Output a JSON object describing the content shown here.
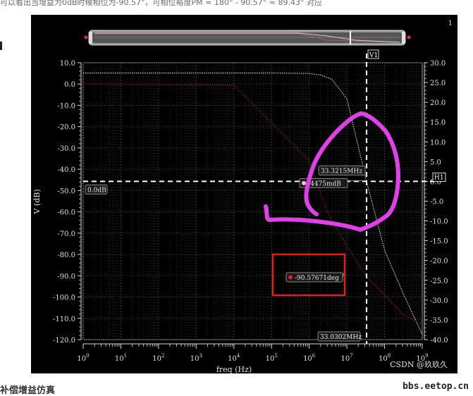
{
  "page": {
    "caption": "可以看出当增益为0dB时候相位为-90.57°，可相位裕度PM = 180° - 90.57° ≈ 89.43° 对应",
    "footer_text": "补偿增益仿真",
    "site_watermark": "bbs.eetop.cn",
    "csdn_watermark": "CSDN @玖玖久",
    "page_number": "1"
  },
  "chart_data": {
    "type": "line",
    "xlabel": "freq (Hz)",
    "ylabel_left": "V (dB)",
    "ylabel_right": "V (deg)",
    "x_scale": "log",
    "xlim": [
      1,
      1000000000
    ],
    "x_ticks": [
      {
        "value": 1,
        "base": "10",
        "exp": "0"
      },
      {
        "value": 10,
        "base": "10",
        "exp": "1"
      },
      {
        "value": 100,
        "base": "10",
        "exp": "2"
      },
      {
        "value": 1000,
        "base": "10",
        "exp": "3"
      },
      {
        "value": 10000,
        "base": "10",
        "exp": "4"
      },
      {
        "value": 100000,
        "base": "10",
        "exp": "5"
      },
      {
        "value": 1000000,
        "base": "10",
        "exp": "6"
      },
      {
        "value": 10000000,
        "base": "10",
        "exp": "7"
      },
      {
        "value": 100000000,
        "base": "10",
        "exp": "8"
      },
      {
        "value": 1000000000,
        "base": "10",
        "exp": "9"
      }
    ],
    "ylim_left": [
      -120,
      10
    ],
    "y_ticks_left": [
      "10.0",
      "0.0",
      "-10.0",
      "-20.0",
      "-30.0",
      "-40.0",
      "-50.0",
      "-60.0",
      "-70.0",
      "-80.0",
      "-90.0",
      "-100.0",
      "-110.0",
      "-120.0"
    ],
    "ylim_right": [
      -40,
      30
    ],
    "y_ticks_right": [
      "30.0",
      "25.0",
      "20.0",
      "15.0",
      "10.0",
      "5.0",
      "0.0",
      "-5.0",
      "-10.0",
      "-15.0",
      "-20.0",
      "-25.0",
      "-30.0",
      "-35.0",
      "-40.0"
    ],
    "grid": true,
    "series": [
      {
        "style": "dotted",
        "color": "#d8d8d8",
        "axis": "right",
        "x": [
          1,
          1000,
          100000,
          1000000,
          2000000,
          4000000,
          10000000,
          33321500,
          100000000,
          300000000,
          1000000000
        ],
        "y": [
          27.4,
          27.4,
          27.4,
          27.3,
          26.9,
          25.8,
          20.9,
          0.0,
          -17.4,
          -28.0,
          -38.7
        ]
      },
      {
        "style": "dotted",
        "color": "#8a1a1a",
        "axis": "left",
        "x": [
          1,
          10000,
          1000000,
          3000000,
          10000000,
          33321500,
          100000000,
          300000000,
          1000000000
        ],
        "y": [
          0.0,
          -0.5,
          -36.0,
          -60.0,
          -76.0,
          -90.6,
          -99.0,
          -108.0,
          -113.0
        ]
      }
    ],
    "markers": {
      "vertical": {
        "label": "V1",
        "x": 33321500
      },
      "horizontal": {
        "label": "H1",
        "y": 0.0
      }
    },
    "annotations": [
      {
        "label": "0.0dB"
      },
      {
        "label": "33.3215MHz"
      },
      {
        "label": "-4475mdB"
      },
      {
        "label": "-90.57671deg"
      },
      {
        "label": "33.0302MHz"
      }
    ],
    "colors": {
      "background": "#000000",
      "grid": "#3a3a3a",
      "marker": "#ffffff",
      "highlight_box": "#e02020",
      "annotation_scribble": "#e040e8"
    }
  }
}
